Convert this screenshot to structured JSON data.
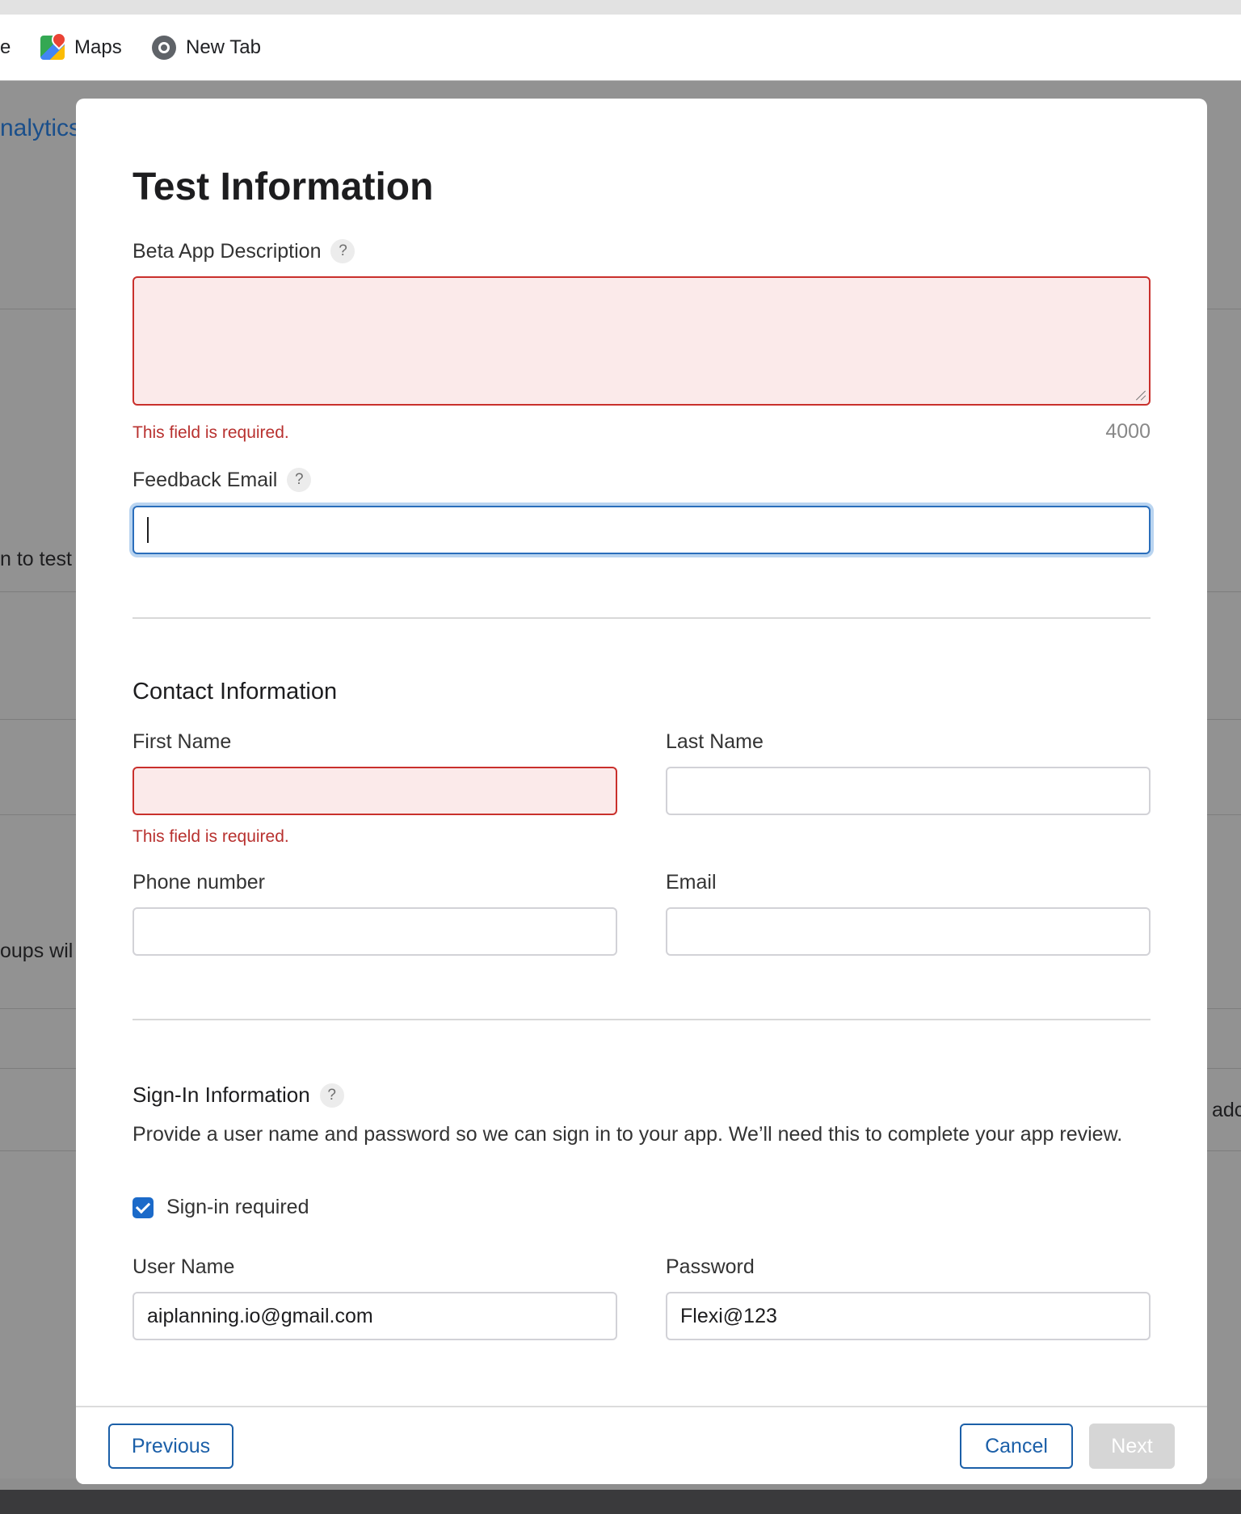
{
  "browser": {
    "bookmarks": [
      {
        "label": "e",
        "icon": "none"
      },
      {
        "label": "Maps",
        "icon": "maps-icon"
      },
      {
        "label": "New Tab",
        "icon": "chrome-icon"
      }
    ]
  },
  "background_page": {
    "nav_link": "nalytics",
    "fragments": [
      "n to test",
      "oups wil",
      "adc"
    ]
  },
  "modal": {
    "title": "Test Information",
    "beta_description": {
      "label": "Beta App Description",
      "help": "?",
      "value": "",
      "error": "This field is required.",
      "counter": "4000"
    },
    "feedback_email": {
      "label": "Feedback Email",
      "help": "?",
      "value": ""
    },
    "contact": {
      "title": "Contact Information",
      "first_name": {
        "label": "First Name",
        "value": "",
        "error": "This field is required."
      },
      "last_name": {
        "label": "Last Name",
        "value": ""
      },
      "phone": {
        "label": "Phone number",
        "value": ""
      },
      "email": {
        "label": "Email",
        "value": ""
      }
    },
    "sign_in": {
      "title": "Sign-In Information",
      "help": "?",
      "description": "Provide a user name and password so we can sign in to your app. We’ll need this to complete your app review.",
      "checkbox_label": "Sign-in required",
      "checkbox_checked": true,
      "user_name": {
        "label": "User Name",
        "value": "aiplanning.io@gmail.com"
      },
      "password": {
        "label": "Password",
        "value": "Flexi@123"
      }
    },
    "footer": {
      "previous": "Previous",
      "cancel": "Cancel",
      "next": "Next"
    }
  },
  "colors": {
    "error": "#c9302c",
    "error_bg": "#fbeaea",
    "accent": "#1b5fa8",
    "focus": "#2a6ebb"
  }
}
